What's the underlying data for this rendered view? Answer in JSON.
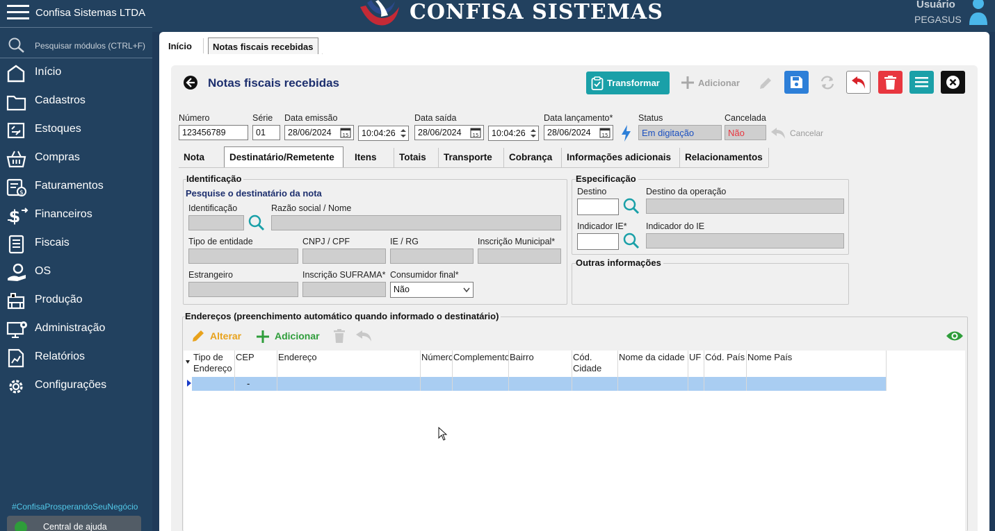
{
  "sidebar": {
    "company": "Confisa Sistemas LTDA",
    "search_placeholder": "Pesquisar módulos (CTRL+F)",
    "items": [
      {
        "label": "Início",
        "icon": "home-icon"
      },
      {
        "label": "Cadastros",
        "icon": "folder-icon"
      },
      {
        "label": "Estoques",
        "icon": "stock-icon"
      },
      {
        "label": "Compras",
        "icon": "basket-icon"
      },
      {
        "label": "Faturamentos",
        "icon": "invoice-icon"
      },
      {
        "label": "Financeiros",
        "icon": "dollar-icon"
      },
      {
        "label": "Fiscais",
        "icon": "document-icon"
      },
      {
        "label": "OS",
        "icon": "hand-gear-icon"
      },
      {
        "label": "Produção",
        "icon": "production-icon"
      },
      {
        "label": "Administração",
        "icon": "monitor-gear-icon"
      },
      {
        "label": "Relatórios",
        "icon": "report-chart-icon"
      },
      {
        "label": "Configurações",
        "icon": "gear-icon"
      }
    ],
    "hashtag": "#ConfisaProsperandoSeuNegócio",
    "help": "Central de ajuda"
  },
  "header": {
    "brand": "CONFISA SISTEMAS",
    "user_label": "Usuário",
    "user_name": "PEGASUS"
  },
  "top_tabs": [
    "Início",
    "Notas fiscais recebidas"
  ],
  "page": {
    "title": "Notas fiscais recebidas",
    "transform_label": "Transformar",
    "add_label": "Adicionar"
  },
  "form": {
    "numero_label": "Número",
    "numero": "123456789",
    "serie_label": "Série",
    "serie": "01",
    "emissao_label": "Data emissão",
    "emissao_date": "28/06/2024",
    "emissao_time": "10:04:26",
    "saida_label": "Data saída",
    "saida_date": "28/06/2024",
    "saida_time": "10:04:26",
    "lancamento_label": "Data lançamento*",
    "lancamento_date": "28/06/2024",
    "status_label": "Status",
    "status": "Em digitação",
    "cancelada_label": "Cancelada",
    "cancelada": "Não",
    "cancelar_label": "Cancelar"
  },
  "panel_tabs": [
    "Nota",
    "Destinatário/Remetente",
    "Itens",
    "Totais",
    "Transporte",
    "Cobrança",
    "Informações adicionais",
    "Relacionamentos"
  ],
  "identificacao": {
    "title": "Identificação",
    "search_hint": "Pesquise o destinatário da nota",
    "id_label": "Identificação",
    "razao_label": "Razão social / Nome",
    "tipo_label": "Tipo de entidade",
    "cnpj_label": "CNPJ / CPF",
    "ie_label": "IE / RG",
    "im_label": "Inscrição Municipal*",
    "estrangeiro_label": "Estrangeiro",
    "suframa_label": "Inscrição SUFRAMA*",
    "consumidor_label": "Consumidor final*",
    "consumidor_value": "Não"
  },
  "especificacao": {
    "title": "Especificação",
    "destino_label": "Destino",
    "destino_op_label": "Destino da operação",
    "ind_ie_label": "Indicador IE*",
    "ind_do_ie_label": "Indicador do IE"
  },
  "outras": {
    "title": "Outras informações"
  },
  "enderecos": {
    "title": "Endereços (preenchimento automático quando informado o destinatário)",
    "alterar": "Alterar",
    "adicionar": "Adicionar",
    "columns": [
      "Tipo de Endereço",
      "CEP",
      "Endereço",
      "Número",
      "Complemento",
      "Bairro",
      "Cód. Cidade",
      "Nome da cidade",
      "UF",
      "Cód. País",
      "Nome País"
    ],
    "row": {
      "cep": "-"
    }
  },
  "colors": {
    "sidebar": "#22415f",
    "accent_teal": "#1aa0a8",
    "save_blue": "#2d7fd8",
    "delete_red": "#e8363f",
    "selected_row": "#a9cdf2",
    "green": "#2e9d3a",
    "orange": "#e8a21c"
  }
}
